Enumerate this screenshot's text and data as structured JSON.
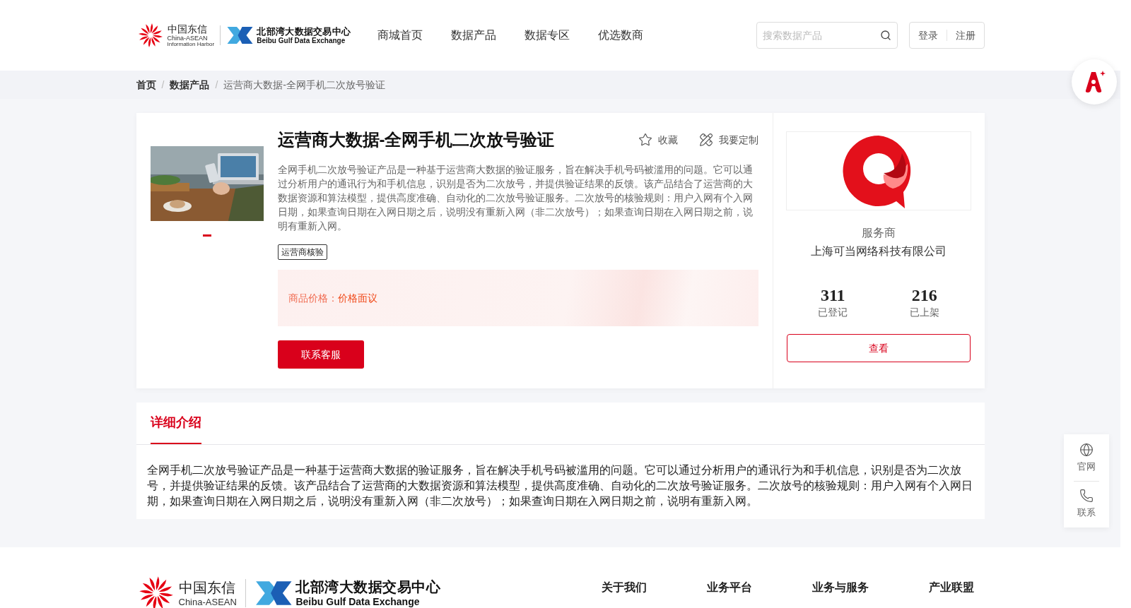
{
  "header": {
    "logo": {
      "cn": "中国东信",
      "en": "China-ASEAN",
      "en_sub": "Information Harbor",
      "exchange_cn": "北部湾大数据交易中心",
      "exchange_en": "Beibu Gulf Data Exchange"
    },
    "nav": [
      "商城首页",
      "数据产品",
      "数据专区",
      "优选数商"
    ],
    "search": {
      "placeholder": "搜索数据产品"
    },
    "auth": [
      "登录",
      "注册"
    ]
  },
  "breadcrumb": [
    "首页",
    "数据产品",
    "运营商大数据-全网手机二次放号验证"
  ],
  "breadcrumb_separator": "/",
  "product": {
    "title": "运营商大数据-全网手机二次放号验证",
    "actions": [
      {
        "kind": "star",
        "label": "收藏"
      },
      {
        "kind": "custom",
        "label": "我要定制"
      }
    ],
    "description": "全网手机二次放号验证产品是一种基于运营商大数据的验证服务，旨在解决手机号码被滥用的问题。它可以通过分析用户的通讯行为和手机信息，识别是否为二次放号，并提供验证结果的反馈。该产品结合了运营商的大数据资源和算法模型，提供高度准确、自动化的二次放号验证服务。二次放号的核验规则：用户入网有个入网日期，如果查询日期在入网日期之后，说明没有重新入网（非二次放号）；如果查询日期在入网日期之前，说明有重新入网。",
    "slides": [
      {
        "selected": true
      }
    ],
    "tags": [
      "运营商核验"
    ],
    "price_label": "商品价格：",
    "price": "价格面议",
    "contact_button": "联系客服"
  },
  "provider": {
    "role": "服务商",
    "name": "上海可当网络科技有限公司",
    "stats": [
      {
        "value": "311",
        "label": "已登记"
      },
      {
        "value": "216",
        "label": "已上架"
      }
    ],
    "view_button": "查看"
  },
  "detail": {
    "tabs": [
      {
        "label": "详细介绍",
        "selected": true
      }
    ],
    "text": "全网手机二次放号验证产品是一种基于运营商大数据的验证服务，旨在解决手机号码被滥用的问题。它可以通过分析用户的通讯行为和手机信息，识别是否为二次放号，并提供验证结果的反馈。该产品结合了运营商的大数据资源和算法模型，提供高度准确、自动化的二次放号验证服务。二次放号的核验规则：用户入网有个入网日期，如果查询日期在入网日期之后，说明没有重新入网（非二次放号）；如果查询日期在入网日期之前，说明有重新入网。"
  },
  "side_float": [
    {
      "kind": "globe",
      "label": "官网"
    },
    {
      "kind": "phone",
      "label": "联系"
    }
  ],
  "footer": {
    "logo": {
      "cn": "中国东信",
      "en": "China-ASEAN",
      "exchange_cn": "北部湾大数据交易中心",
      "exchange_en": "Beibu Gulf Data Exchange"
    },
    "columns": [
      "关于我们",
      "业务平台",
      "业务与服务",
      "产业联盟"
    ]
  }
}
